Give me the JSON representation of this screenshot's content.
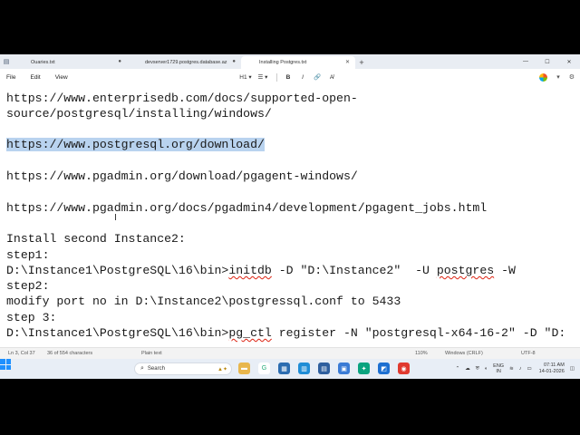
{
  "tabs": [
    {
      "label": "Ouaries.txt",
      "active": false
    },
    {
      "label": "devserver1729.postgres.database.az",
      "active": false
    },
    {
      "label": "Installing Postgres.txt",
      "active": true
    }
  ],
  "menu": [
    "File",
    "Edit",
    "View"
  ],
  "format": {
    "heading": "H1 ▾",
    "list": "☰ ▾",
    "bold": "B",
    "italic": "I",
    "link": "🔗",
    "clear": "A̸"
  },
  "window": {
    "minimize": "—",
    "maximize": "☐",
    "close": "✕"
  },
  "editor_lines": [
    "https://www.enterprisedb.com/docs/supported-open-",
    "source/postgresql/installing/windows/",
    "",
    "https://www.postgresql.org/download/",
    "",
    "https://www.pgadmin.org/download/pgagent-windows/",
    "",
    "https://www.pgadmin.org/docs/pgadmin4/development/pgagent_jobs.html",
    "",
    "Install second Instance2:",
    "step1:",
    "",
    "step2:",
    "modify port no in D:\\Instance2\\postgressql.conf to 5433",
    "step 3:",
    ""
  ],
  "cmd1": {
    "pre": "D:\\Instance1\\PostgreSQL\\16\\bin>",
    "word": "initdb",
    "mid": " -D \"D:\\Instance2\"  -U ",
    "word2": "postgres",
    "post": " -W"
  },
  "cmd2": {
    "pre": "D:\\Instance1\\PostgreSQL\\16\\bin>",
    "word": "pg_ctl",
    "post": " register -N \"postgresql-x64-16-2\" -D \"D:"
  },
  "status": {
    "position": "Ln 3, Col 37",
    "chars": "36 of 554 characters",
    "format": "Plain text",
    "zoom": "110%",
    "eol": "Windows (CRLF)",
    "encoding": "UTF-8"
  },
  "taskbar": {
    "search_placeholder": "Search",
    "lang_1": "ENG",
    "lang_2": "IN",
    "time": "07:11 AM",
    "date": "14-01-2026"
  }
}
